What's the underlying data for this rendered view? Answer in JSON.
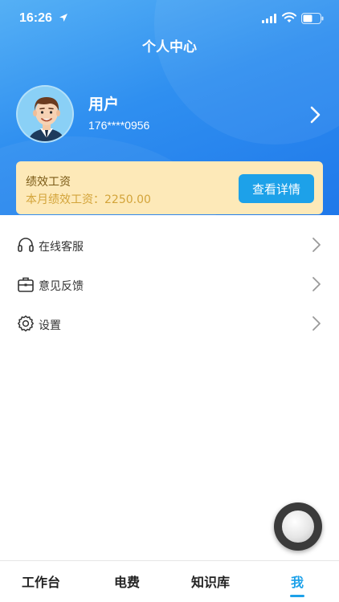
{
  "status_bar": {
    "time": "16:26"
  },
  "header": {
    "title": "个人中心"
  },
  "profile": {
    "name": "用户",
    "phone": "176****0956"
  },
  "performance": {
    "title": "绩效工资",
    "value_text": "本月绩效工资：2250.00",
    "button_label": "查看详情"
  },
  "menu": {
    "items": [
      {
        "label": "在线客服",
        "icon": "headset-icon"
      },
      {
        "label": "意见反馈",
        "icon": "briefcase-icon"
      },
      {
        "label": "设置",
        "icon": "gear-icon"
      }
    ]
  },
  "tabbar": {
    "tabs": [
      {
        "label": "工作台"
      },
      {
        "label": "电费"
      },
      {
        "label": "知识库"
      },
      {
        "label": "我"
      }
    ],
    "active_index": 3
  },
  "colors": {
    "header_blue": "#2f8ff0",
    "accent_blue": "#1da1e9",
    "card_bg": "#fde9b8",
    "card_value": "#d3a43a"
  }
}
